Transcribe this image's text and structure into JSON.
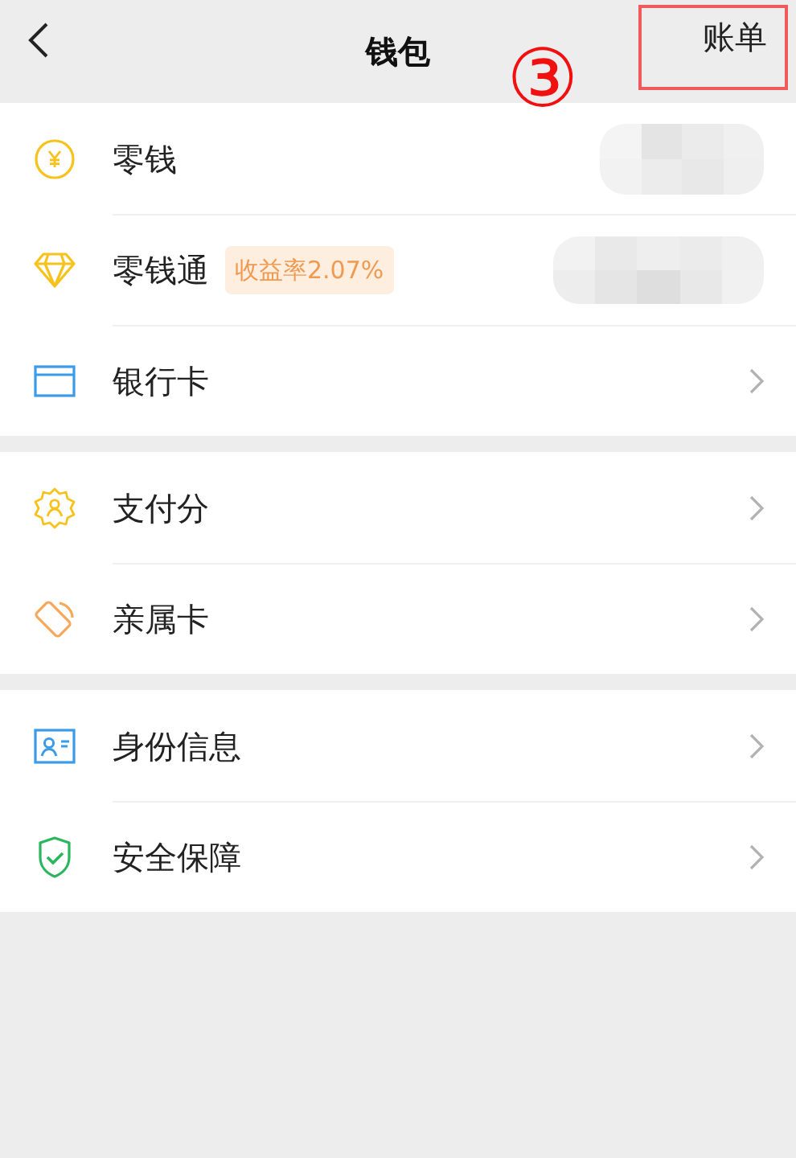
{
  "header": {
    "title": "钱包",
    "action": "账单"
  },
  "annotation": {
    "step": "③"
  },
  "sections": [
    [
      {
        "kind": "balance",
        "label": "零钱"
      },
      {
        "kind": "balance",
        "label": "零钱通",
        "badge": "收益率2.07%"
      },
      {
        "kind": "link",
        "label": "银行卡"
      }
    ],
    [
      {
        "kind": "link",
        "label": "支付分"
      },
      {
        "kind": "link",
        "label": "亲属卡"
      }
    ],
    [
      {
        "kind": "link",
        "label": "身份信息"
      },
      {
        "kind": "link",
        "label": "安全保障"
      }
    ]
  ]
}
